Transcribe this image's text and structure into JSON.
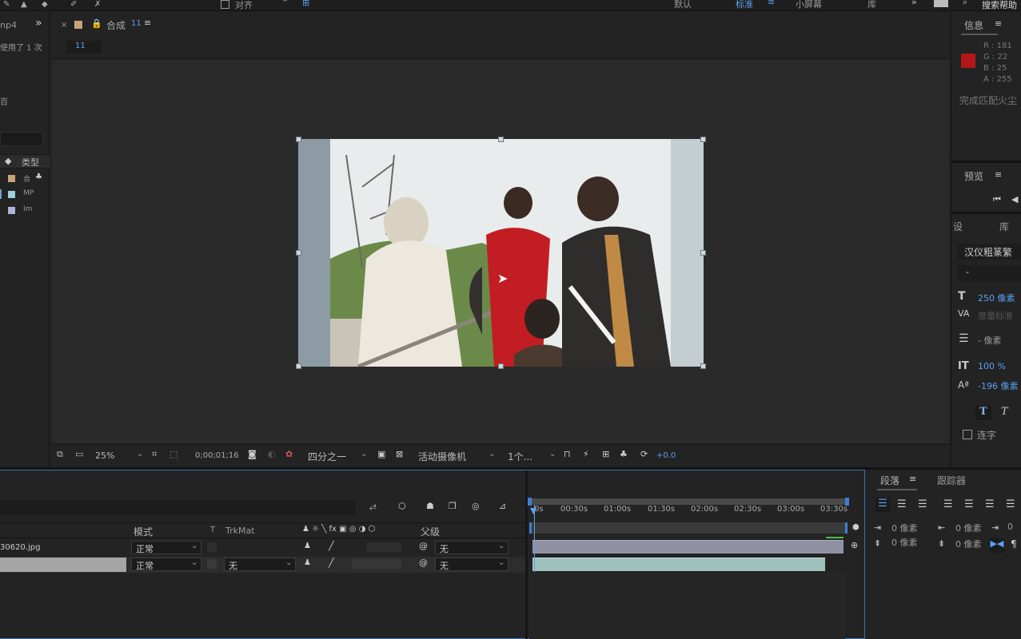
{
  "top_bar": {
    "align_label": "对齐",
    "workspaces": [
      "默认",
      "标准",
      "小屏幕",
      "库"
    ],
    "active_workspace": "标准",
    "search_label": "搜索帮助"
  },
  "project_panel": {
    "file_fragment": "np4",
    "used_text": "使用了 1 次",
    "small_text": "百",
    "type_header": "类型",
    "rows": [
      {
        "type": "合",
        "color": "#c9a47a"
      },
      {
        "type": "MP",
        "color": "#9fd0d8"
      },
      {
        "type": "Im",
        "color": "#b0b4d8"
      }
    ]
  },
  "comp_panel": {
    "tab_label": "合成",
    "comp_name": "11",
    "breadcrumb": "11"
  },
  "viewer_toolbar": {
    "zoom": "25%",
    "timecode": "0;00;01;16",
    "resolution": "四分之一",
    "camera": "活动摄像机",
    "views": "1个...",
    "exposure": "+0.0"
  },
  "info_panel": {
    "title": "信息",
    "swatch_color": "#b51619",
    "r": "R : 181",
    "g": "G : 22",
    "b": "B : 25",
    "a": "A : 255",
    "status": "完成匹配火尘"
  },
  "preview_panel": {
    "title": "预览"
  },
  "char_panel": {
    "tab1": "设",
    "tab2": "库",
    "font": "汉仪粗篆繁",
    "style": "-",
    "size": "250 像素",
    "kerning_label": "度量标准",
    "leading": "- 像素",
    "vscale": "100 %",
    "baseline": "-196 像素",
    "ligature": "连字"
  },
  "timeline": {
    "col_mode": "模式",
    "col_t": "T",
    "col_trkmat": "TrkMat",
    "col_parent": "父级",
    "layers": [
      {
        "name": "30620.jpg",
        "mode": "正常",
        "trkmat": "",
        "parent": "无"
      },
      {
        "name": "",
        "mode": "正常",
        "trkmat": "无",
        "parent": "无"
      }
    ],
    "ruler": [
      "0s",
      "00:30s",
      "01:00s",
      "01:30s",
      "02:00s",
      "02:30s",
      "03:00s",
      "03:30s"
    ]
  },
  "paragraph_panel": {
    "tab1": "段落",
    "tab2": "跟踪器",
    "indent_left": "0 像素",
    "indent_right": "0 像素",
    "indent_first": "0",
    "space_before": "0 像素",
    "space_after": "0 像素"
  }
}
